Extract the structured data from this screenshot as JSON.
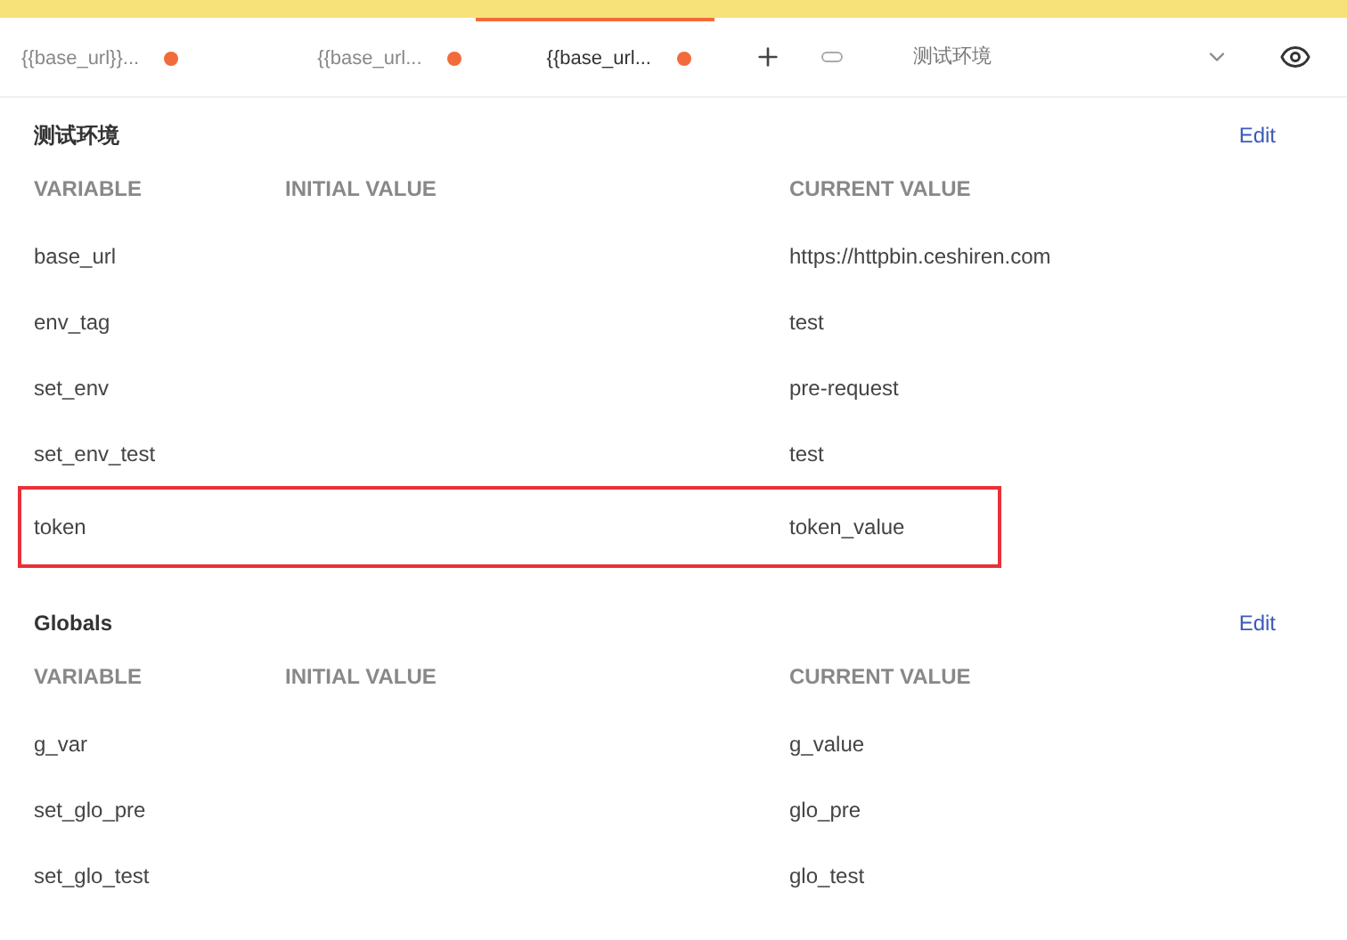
{
  "tabs": [
    {
      "label": "{{base_url}}...",
      "unsaved": true,
      "selected": false
    },
    {
      "label": "{{base_url...",
      "unsaved": true,
      "selected": false
    },
    {
      "label": "{{base_url...",
      "unsaved": true,
      "selected": true
    }
  ],
  "environment_select": {
    "value": "测试环境"
  },
  "sections": [
    {
      "title": "测试环境",
      "edit_link": "Edit",
      "columns": [
        "VARIABLE",
        "INITIAL VALUE",
        "CURRENT VALUE"
      ],
      "rows": [
        {
          "variable": "base_url",
          "current": "https://httpbin.ceshiren.com",
          "highlighted": false
        },
        {
          "variable": "env_tag",
          "current": "test",
          "highlighted": false
        },
        {
          "variable": "set_env",
          "current": "pre-request",
          "highlighted": false
        },
        {
          "variable": "set_env_test",
          "current": "test",
          "highlighted": false
        },
        {
          "variable": "token",
          "current": "token_value",
          "highlighted": true
        }
      ]
    },
    {
      "title": "Globals",
      "edit_link": "Edit",
      "columns": [
        "VARIABLE",
        "INITIAL VALUE",
        "CURRENT VALUE"
      ],
      "rows": [
        {
          "variable": "g_var",
          "current": "g_value",
          "highlighted": false
        },
        {
          "variable": "set_glo_pre",
          "current": "glo_pre",
          "highlighted": false
        },
        {
          "variable": "set_glo_test",
          "current": "glo_test",
          "highlighted": false
        }
      ]
    }
  ]
}
